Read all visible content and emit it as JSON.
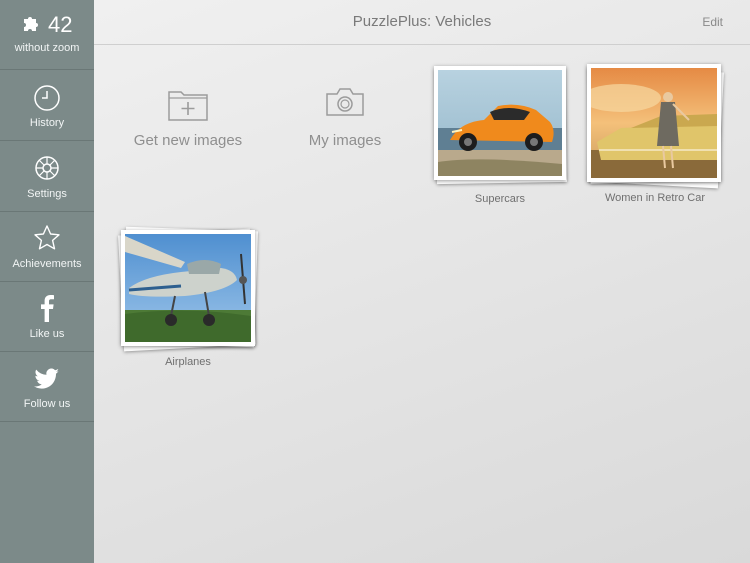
{
  "sidebar": {
    "score": {
      "value": "42",
      "label": "without zoom",
      "icon": "puzzle-piece-icon"
    },
    "items": [
      {
        "label": "History",
        "icon": "clock-icon"
      },
      {
        "label": "Settings",
        "icon": "gear-icon"
      },
      {
        "label": "Achievements",
        "icon": "star-icon"
      },
      {
        "label": "Like us",
        "icon": "facebook-icon"
      },
      {
        "label": "Follow us",
        "icon": "twitter-icon"
      }
    ]
  },
  "header": {
    "title": "PuzzlePlus: Vehicles",
    "edit_label": "Edit"
  },
  "actions": [
    {
      "label": "Get new images",
      "icon": "add-folder-icon"
    },
    {
      "label": "My images",
      "icon": "camera-icon"
    }
  ],
  "albums": [
    {
      "label": "Supercars"
    },
    {
      "label": "Women in Retro Car"
    },
    {
      "label": "Airplanes"
    }
  ],
  "colors": {
    "sidebar": "#7c8a89",
    "background": "#e6e6e6",
    "text": "#8f8f8f"
  }
}
